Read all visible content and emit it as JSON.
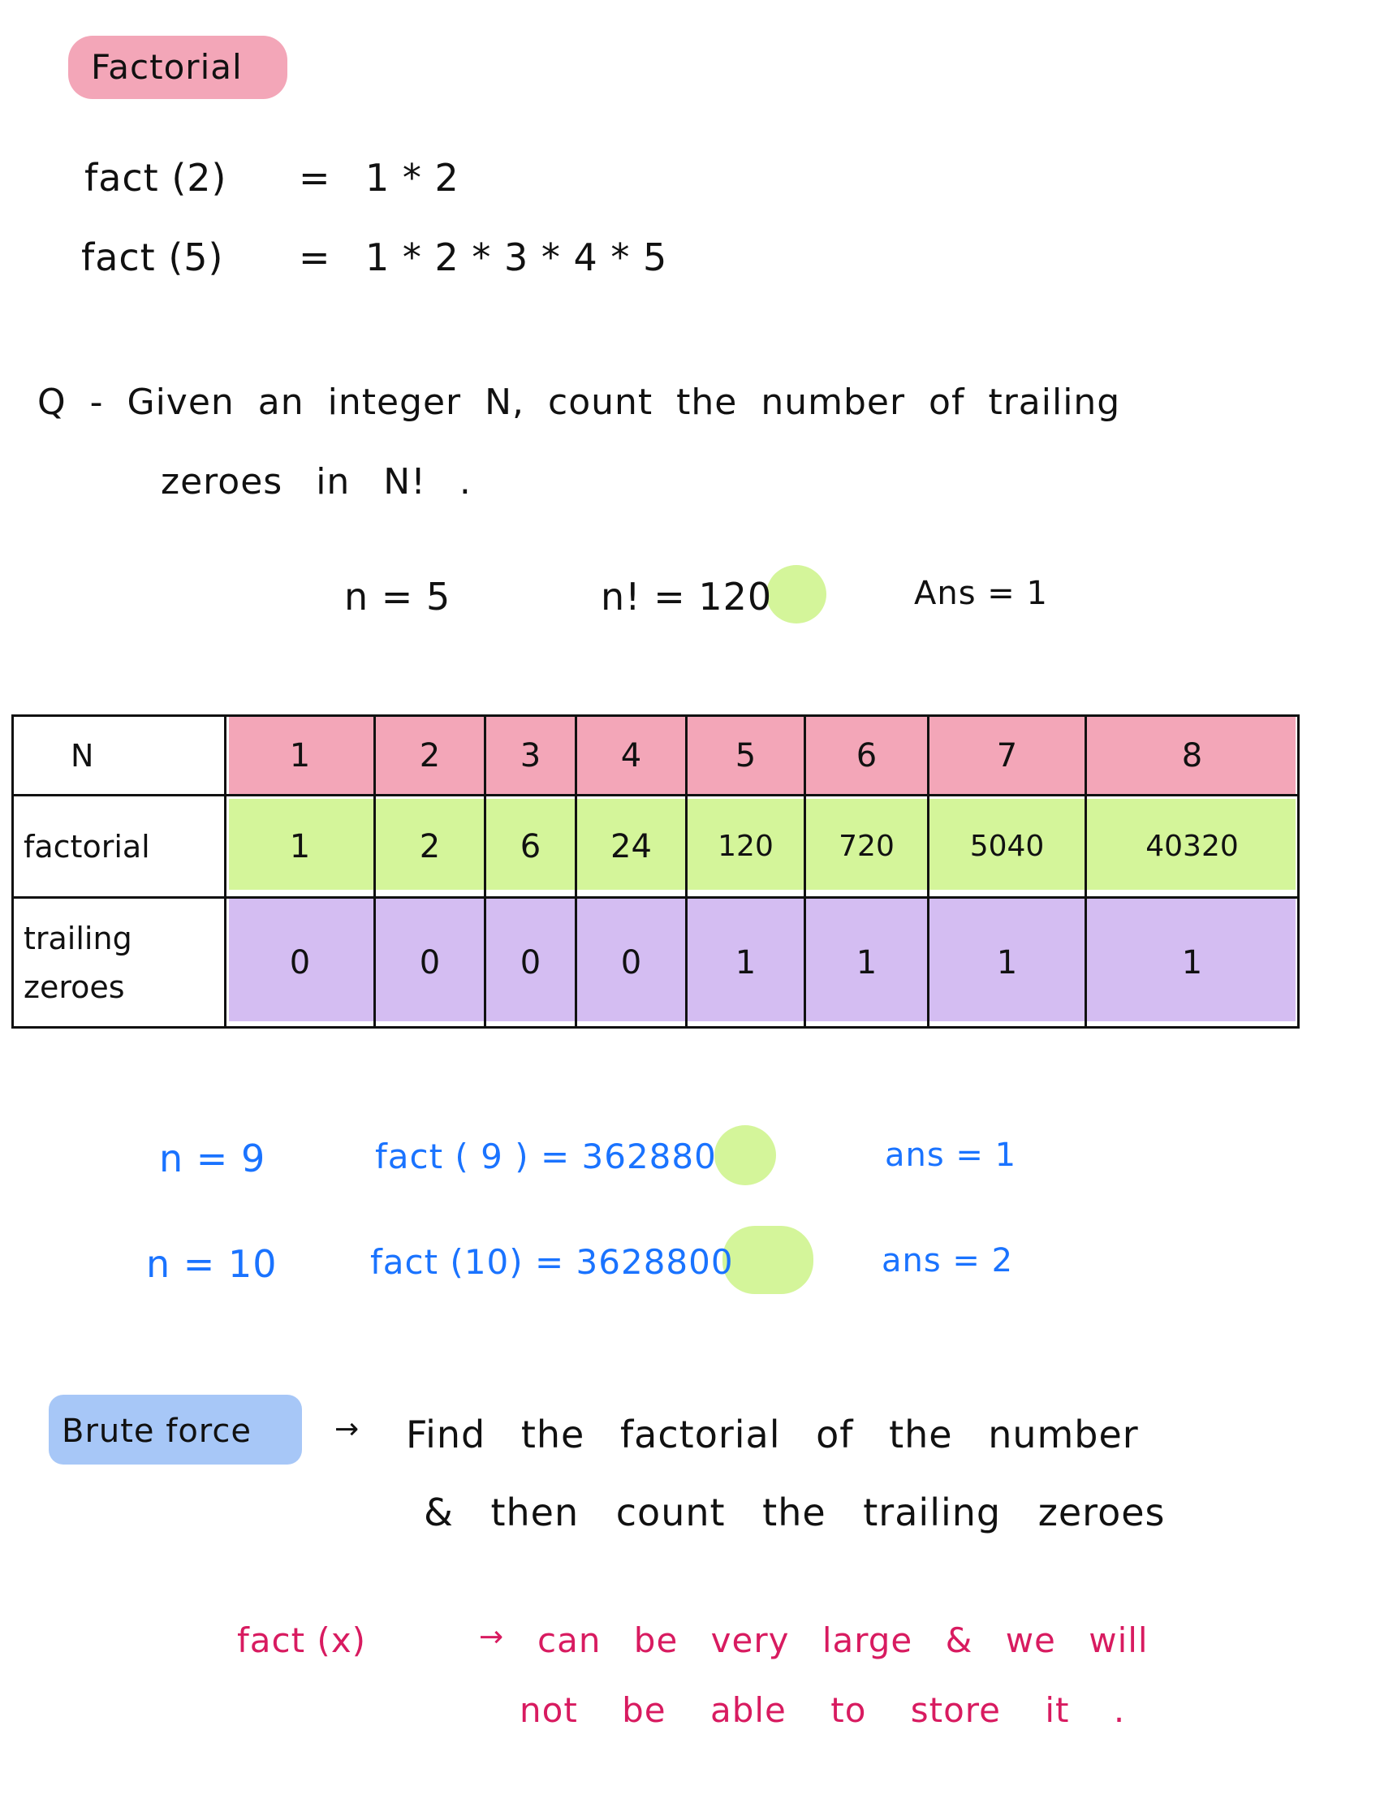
{
  "title": "Factorial",
  "examples": [
    {
      "lhs": "fact (2)",
      "eq": "=",
      "rhs": "1 * 2"
    },
    {
      "lhs": "fact (5)",
      "eq": "=",
      "rhs": "1 * 2 * 3 * 4 * 5"
    }
  ],
  "question": {
    "line1": "Q - Given an integer N, count the number of trailing",
    "line2": "zeroes in N! ."
  },
  "case5": {
    "n": "n = 5",
    "fact": "n! = 120",
    "ans": "Ans = 1"
  },
  "table": {
    "row_labels": [
      "N",
      "factorial",
      "trailing zeroes"
    ],
    "n": [
      "1",
      "2",
      "3",
      "4",
      "5",
      "6",
      "7",
      "8"
    ],
    "factorial": [
      "1",
      "2",
      "6",
      "24",
      "120",
      "720",
      "5040",
      "40320"
    ],
    "trailing": [
      "0",
      "0",
      "0",
      "0",
      "1",
      "1",
      "1",
      "1"
    ]
  },
  "case9": {
    "n": "n = 9",
    "fact": "fact ( 9 ) = 362880",
    "ans": "ans = 1"
  },
  "case10": {
    "n": "n = 10",
    "fact": "fact (10) = 3628800",
    "ans": "ans = 2"
  },
  "brute": {
    "label": "Brute force",
    "arrow": "→",
    "line1": "Find the factorial of the number",
    "line2": "& then count the trailing zeroes"
  },
  "note": {
    "lhs": "fact (x)",
    "arrow": "→",
    "line1": "can be very large & we will",
    "line2": "not be able to store it ."
  },
  "colors": {
    "pink_highlight": "#f3a6b8",
    "green_highlight": "#d4f59a",
    "purple_highlight": "#d4bdf2",
    "blue_highlight": "#a7c7f7",
    "blue_ink": "#1a73ff",
    "pink_ink": "#d81b60"
  }
}
